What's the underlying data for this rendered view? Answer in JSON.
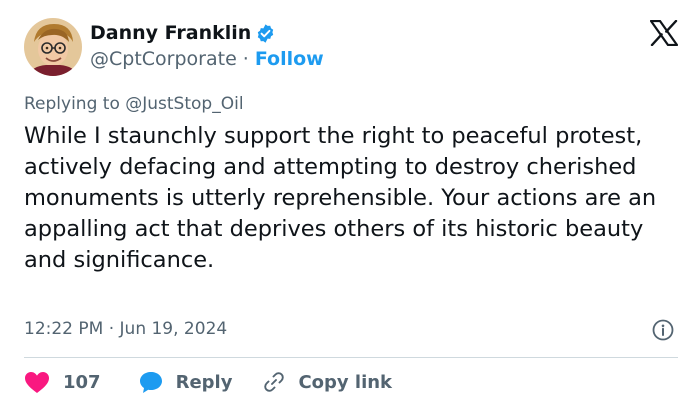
{
  "author": {
    "display_name": "Danny Franklin",
    "handle": "@CptCorporate",
    "separator": "·",
    "follow_label": "Follow",
    "verified_color": "#1d9bf0"
  },
  "icons": {
    "verified": "verified-badge-icon",
    "brand": "x-logo-icon",
    "info": "info-icon",
    "like": "heart-icon",
    "reply": "speech-bubble-icon",
    "copy": "link-icon"
  },
  "reply_context": {
    "prefix": "Replying to",
    "mention": "@JustStop_Oil"
  },
  "tweet": {
    "text": "While I staunchly support the right to peaceful protest, actively defacing and attempting to destroy cherished monuments is utterly reprehensible. Your actions are an appalling act that deprives others of its historic beauty and significance."
  },
  "meta": {
    "timestamp": "12:22 PM · Jun 19, 2024"
  },
  "actions": {
    "like_count": "107",
    "reply_label": "Reply",
    "copy_label": "Copy link"
  },
  "colors": {
    "like": "#f91880",
    "reply": "#1d9bf0",
    "secondary_text": "#536471",
    "accent": "#1d9bf0"
  }
}
